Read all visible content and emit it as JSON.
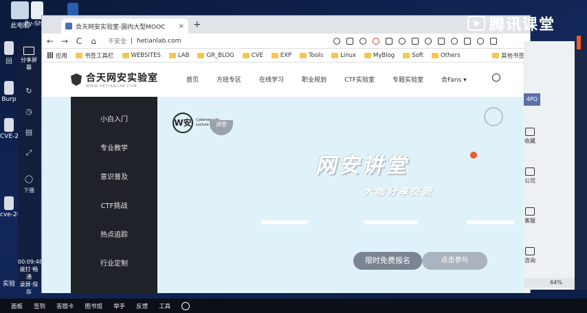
{
  "desktop": {
    "icons": [
      {
        "label": "此电脑"
      },
      {
        "label": "Py-Shell"
      },
      {
        "label": "回"
      },
      {
        "label": "Burp"
      },
      {
        "label": "CVE-2"
      },
      {
        "label": "cve-2("
      },
      {
        "label": "实验"
      }
    ]
  },
  "share_panel": {
    "title": "分享屏幕",
    "items": [
      "↻",
      "◷",
      "▤",
      "⤢",
      "◯"
    ],
    "bottom_label": "下播",
    "time": "00:09:48",
    "status_lines": [
      "拨打·畅通",
      "录屏·保存"
    ]
  },
  "watermark": {
    "text": "腾讯课堂"
  },
  "browser": {
    "tab_title": "合天网安实验室-国内大型MOOC",
    "tab_close": "×",
    "new_tab": "+",
    "nav": {
      "back": "←",
      "forward": "→",
      "reload": "C",
      "home": "⌂"
    },
    "address": {
      "security": "不安全",
      "separator": "|",
      "url": "hetianlab.com"
    },
    "bookmarks": [
      {
        "label": "应用",
        "type": "apps"
      },
      {
        "label": "书签工具栏",
        "type": "folder"
      },
      {
        "label": "WEBSITES",
        "type": "folder"
      },
      {
        "label": "LAB",
        "type": "folder"
      },
      {
        "label": "GR_BLOG",
        "type": "folder"
      },
      {
        "label": "CVE",
        "type": "folder"
      },
      {
        "label": "EXP",
        "type": "folder"
      },
      {
        "label": "Tools",
        "type": "folder"
      },
      {
        "label": "Linux",
        "type": "folder"
      },
      {
        "label": "MyBlog",
        "type": "folder"
      },
      {
        "label": "Soft",
        "type": "folder"
      },
      {
        "label": "Others",
        "type": "folder"
      }
    ],
    "bookmarks_other": "其他书签"
  },
  "site": {
    "logo_name": "合天网安实验室",
    "logo_sub": "WWW.HETIANLAB.COM",
    "nav": [
      "首页",
      "方班专区",
      "在线学习",
      "职业规划",
      "CTF实验室",
      "专题实验室",
      "合Fans ▾"
    ],
    "side_menu": [
      "小白入门",
      "专业教学",
      "意识普及",
      "CTF挑战",
      "热点追踪",
      "行业定制"
    ],
    "hero": {
      "lecture_logo_letter": "W安",
      "lecture_logo_text": "Cybersecurity Lecture",
      "lecture_badge": "讲堂",
      "title": "网安讲堂",
      "subtitle": "大咖分享交流",
      "btn_register": "限时免费报名",
      "btn_join": "点击参与"
    }
  },
  "right_window": {
    "top_badge": "4PQ",
    "items": [
      "收藏",
      "公司",
      "客服",
      "咨询"
    ],
    "zoom": "64%"
  },
  "taskbar": {
    "items": [
      "面板",
      "签到",
      "答题卡",
      "图书馆",
      "举手",
      "反馈",
      "工具"
    ]
  }
}
